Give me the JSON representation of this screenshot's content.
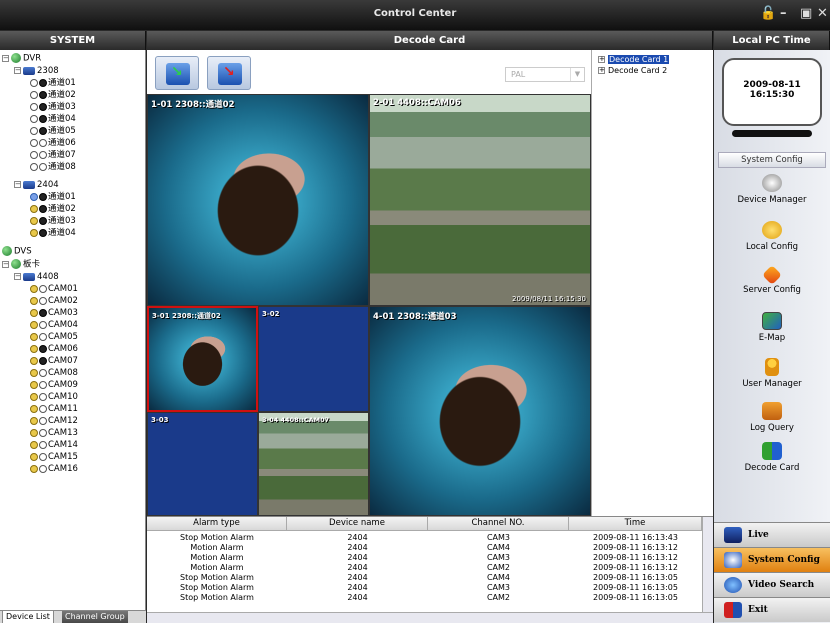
{
  "window": {
    "title": "Control Center"
  },
  "headers": {
    "system": "SYSTEM",
    "decode": "Decode Card",
    "time": "Local PC Time"
  },
  "tree": {
    "root_dvr": "DVR",
    "dvr_2308": "2308",
    "ch2308": [
      "通道01",
      "通道02",
      "通道03",
      "通道04",
      "通道05",
      "通道06",
      "通道07",
      "通道08"
    ],
    "dvr_2404": "2404",
    "ch2404": [
      "通道01",
      "通道02",
      "通道03",
      "通道04"
    ],
    "root_dvs": "DVS",
    "root_card": "板卡",
    "card_4408": "4408",
    "cams": [
      "CAM01",
      "CAM02",
      "CAM03",
      "CAM04",
      "CAM05",
      "CAM06",
      "CAM07",
      "CAM08",
      "CAM09",
      "CAM10",
      "CAM11",
      "CAM12",
      "CAM13",
      "CAM14",
      "CAM15",
      "CAM16"
    ]
  },
  "tabs": {
    "device_list": "Device List",
    "channel_group": "Channel Group"
  },
  "toolbar": {
    "format": "PAL"
  },
  "cards": {
    "card1": "Decode Card 1",
    "card2": "Decode Card 2"
  },
  "video": {
    "v1": "1-01  2308::通道02",
    "v2": "2-01  4408::CAM06",
    "v2_time": "2009/08/11  16:15:30",
    "v3a": "3-01  2308::通道02",
    "v3b": "3-02",
    "v3c": "3-03",
    "v3d": "3-04  4408::CAM07",
    "v4": "4-01  2308::通道03"
  },
  "alarm": {
    "headers": [
      "Alarm type",
      "Device name",
      "Channel NO.",
      "Time"
    ],
    "rows": [
      [
        "Stop Motion Alarm",
        "2404",
        "CAM3",
        "2009-08-11 16:13:43"
      ],
      [
        "Motion Alarm",
        "2404",
        "CAM4",
        "2009-08-11 16:13:12"
      ],
      [
        "Motion Alarm",
        "2404",
        "CAM3",
        "2009-08-11 16:13:12"
      ],
      [
        "Motion Alarm",
        "2404",
        "CAM2",
        "2009-08-11 16:13:12"
      ],
      [
        "Stop Motion Alarm",
        "2404",
        "CAM4",
        "2009-08-11 16:13:05"
      ],
      [
        "Stop Motion Alarm",
        "2404",
        "CAM3",
        "2009-08-11 16:13:05"
      ],
      [
        "Stop Motion Alarm",
        "2404",
        "CAM2",
        "2009-08-11 16:13:05"
      ]
    ]
  },
  "clock": {
    "date": "2009-08-11",
    "time": "16:15:30"
  },
  "sidebar": {
    "section": "System Config",
    "items": [
      "Device Manager",
      "Local Config",
      "Server Config",
      "E-Map",
      "User Manager",
      "Log Query",
      "Decode Card"
    ]
  },
  "nav": {
    "live": "Live",
    "system_config": "System Config",
    "video_search": "Video Search",
    "exit": "Exit"
  }
}
